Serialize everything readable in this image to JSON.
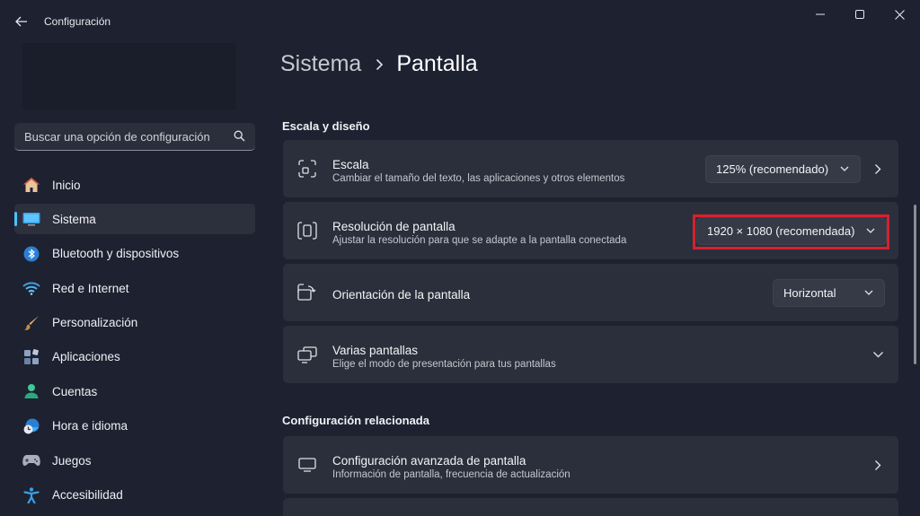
{
  "window": {
    "title": "Configuración"
  },
  "search": {
    "placeholder": "Buscar una opción de configuración"
  },
  "sidebar": {
    "items": [
      {
        "label": "Inicio",
        "icon": "home-icon"
      },
      {
        "label": "Sistema",
        "icon": "system-icon",
        "active": true
      },
      {
        "label": "Bluetooth y dispositivos",
        "icon": "bluetooth-icon"
      },
      {
        "label": "Red e Internet",
        "icon": "wifi-icon"
      },
      {
        "label": "Personalización",
        "icon": "brush-icon"
      },
      {
        "label": "Aplicaciones",
        "icon": "apps-icon"
      },
      {
        "label": "Cuentas",
        "icon": "account-icon"
      },
      {
        "label": "Hora e idioma",
        "icon": "clock-globe-icon"
      },
      {
        "label": "Juegos",
        "icon": "gamepad-icon"
      },
      {
        "label": "Accesibilidad",
        "icon": "accessibility-icon"
      }
    ]
  },
  "breadcrumb": {
    "parent": "Sistema",
    "current": "Pantalla"
  },
  "sections": {
    "scale_layout": "Escala y diseño",
    "related": "Configuración relacionada"
  },
  "cards": {
    "scale": {
      "title": "Escala",
      "subtitle": "Cambiar el tamaño del texto, las aplicaciones y otros elementos",
      "value": "125% (recomendado)"
    },
    "resolution": {
      "title": "Resolución de pantalla",
      "subtitle": "Ajustar la resolución para que se adapte a la pantalla conectada",
      "value": "1920 × 1080 (recomendada)"
    },
    "orientation": {
      "title": "Orientación de la pantalla",
      "value": "Horizontal"
    },
    "multiple": {
      "title": "Varias pantallas",
      "subtitle": "Elige el modo de presentación para tus pantallas"
    },
    "advanced": {
      "title": "Configuración avanzada de pantalla",
      "subtitle": "Información de pantalla, frecuencia de actualización"
    }
  },
  "colors": {
    "accent": "#4cc2ff",
    "highlight": "#d8202e",
    "background": "#1d2130",
    "card": "#2b2f3b"
  }
}
